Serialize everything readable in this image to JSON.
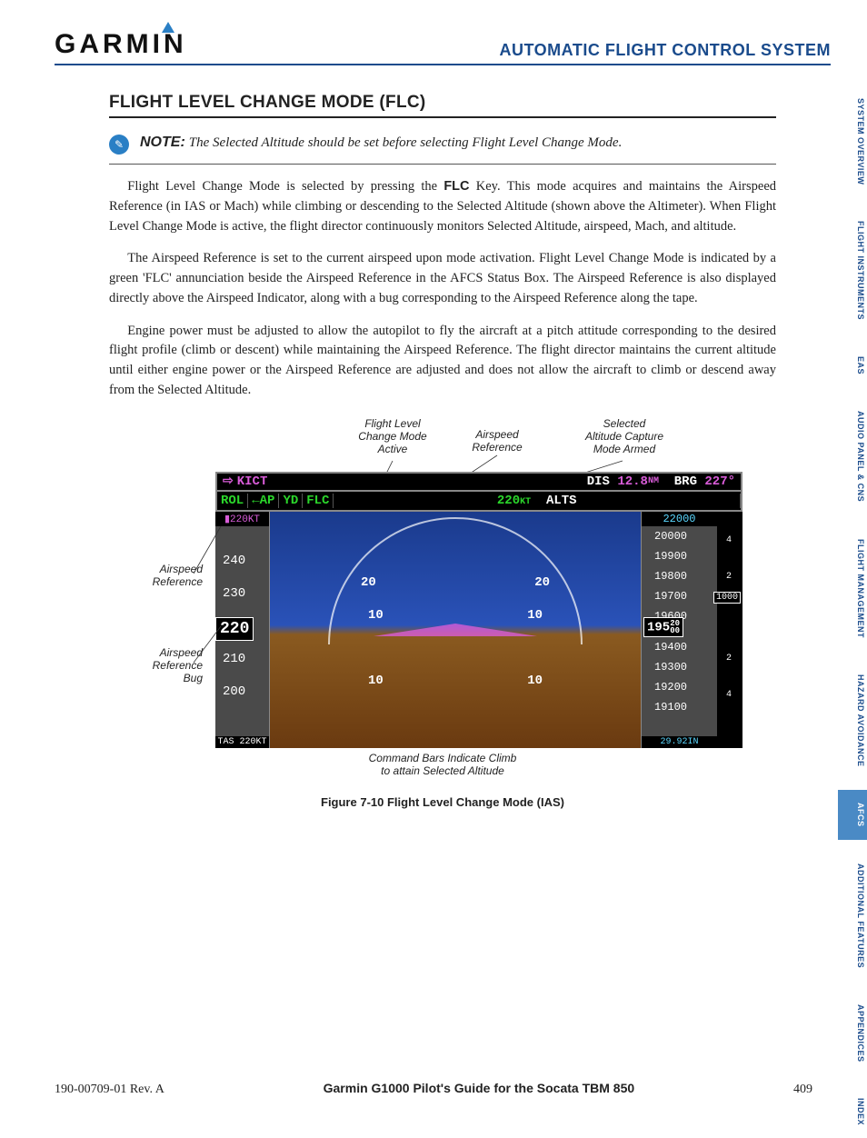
{
  "header": {
    "logo_text": "GARMIN",
    "title": "AUTOMATIC FLIGHT CONTROL SYSTEM"
  },
  "section": {
    "title": "FLIGHT LEVEL CHANGE MODE (FLC)"
  },
  "note": {
    "label": "NOTE:",
    "text": "The Selected Altitude should be set before selecting Flight Level Change Mode."
  },
  "paragraphs": {
    "p1a": "Flight Level Change Mode is selected by pressing the ",
    "p1key": "FLC",
    "p1b": " Key.  This mode acquires and maintains the Airspeed Reference (in IAS or Mach) while climbing or descending to the Selected Altitude (shown above the Altimeter).  When Flight Level Change Mode is active, the flight director continuously monitors Selected Altitude, airspeed, Mach, and altitude.",
    "p2": "The Airspeed Reference is set to the current airspeed upon mode activation.  Flight Level Change Mode is indicated by a green 'FLC' annunciation beside the Airspeed Reference in the AFCS Status Box.  The Airspeed Reference is also displayed directly above the Airspeed Indicator, along with a bug corresponding to the Airspeed Reference along the tape.",
    "p3": "Engine power must be adjusted to allow the autopilot to fly the aircraft at a pitch attitude corresponding to the desired flight profile (climb or descent) while maintaining the Airspeed Reference.  The flight director maintains the current altitude until either engine power or the Airspeed Reference are adjusted and does not allow the aircraft to climb or descend away from the Selected Altitude."
  },
  "callouts": {
    "flc_active": "Flight Level\nChange Mode\nActive",
    "airspeed_ref": "Airspeed\nReference",
    "alt_capture": "Selected\nAltitude Capture\nMode Armed",
    "asr_left": "Airspeed\nReference",
    "asr_bug": "Airspeed\nReference\nBug",
    "cmd_bars": "Command Bars Indicate Climb\nto attain Selected Altitude"
  },
  "pfd": {
    "nav": {
      "wpt": "KICT",
      "dis_lbl": "DIS",
      "dis": "12.8",
      "dis_unit": "NM",
      "brg_lbl": "BRG",
      "brg": "227°"
    },
    "mode": {
      "rol": "ROL",
      "ap": "←AP",
      "yd": "YD",
      "flc": "FLC",
      "ias": "220",
      "ias_unit": "KT",
      "alts": "ALTS"
    },
    "asi": {
      "ref": "220KT",
      "ticks": [
        "240",
        "230",
        "220",
        "210",
        "200"
      ],
      "readout": "220",
      "tas": "TAS 220KT"
    },
    "adi": {
      "p20l": "20",
      "p20r": "20",
      "p10l": "10",
      "p10r": "10",
      "m10l": "10",
      "m10r": "10"
    },
    "alt": {
      "sel": "22000",
      "ticks": [
        "20000",
        "19900",
        "19800",
        "19700",
        "19600",
        "19400",
        "19300",
        "19200",
        "19100"
      ],
      "readout_main": "195",
      "readout_sub": "20\n00",
      "baro": "29.92IN"
    },
    "vsi": {
      "up4": "4",
      "up2": "2",
      "dn2": "2",
      "dn4": "4",
      "ptr": "1000"
    }
  },
  "figure_caption": "Figure 7-10  Flight Level Change Mode (IAS)",
  "tabs": [
    {
      "label": "SYSTEM OVERVIEW",
      "active": false
    },
    {
      "label": "FLIGHT INSTRUMENTS",
      "active": false
    },
    {
      "label": "EAS",
      "active": false
    },
    {
      "label": "AUDIO PANEL & CNS",
      "active": false
    },
    {
      "label": "FLIGHT MANAGEMENT",
      "active": false
    },
    {
      "label": "HAZARD AVOIDANCE",
      "active": false
    },
    {
      "label": "AFCS",
      "active": true
    },
    {
      "label": "ADDITIONAL FEATURES",
      "active": false
    },
    {
      "label": "APPENDICES",
      "active": false
    },
    {
      "label": "INDEX",
      "active": false
    }
  ],
  "footer": {
    "rev": "190-00709-01  Rev. A",
    "title": "Garmin G1000 Pilot's Guide for the Socata TBM 850",
    "page": "409"
  }
}
